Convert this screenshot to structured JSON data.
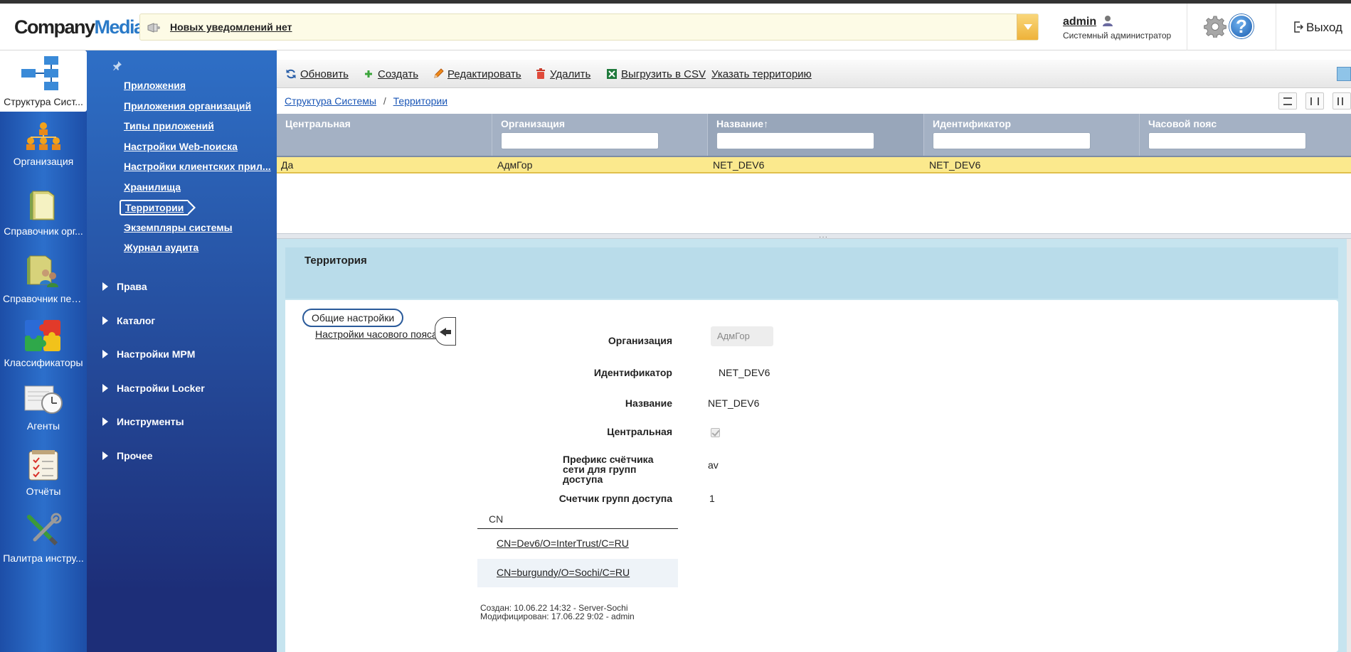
{
  "header": {
    "logo_company": "Company",
    "logo_media": "Media",
    "notification": "Новых уведомлений нет",
    "user_name": "admin",
    "user_role": "Системный администратор",
    "help_symbol": "?",
    "logout": "Выход"
  },
  "rail": {
    "items": [
      {
        "label": "Структура Сист...",
        "icon": "structure-icon",
        "active": true
      },
      {
        "label": "Организация",
        "icon": "org-chart-icon"
      },
      {
        "label": "Справочник орг...",
        "icon": "folder-icon"
      },
      {
        "label": "Справочник пер...",
        "icon": "people-folder-icon"
      },
      {
        "label": "Классификаторы",
        "icon": "puzzle-icon"
      },
      {
        "label": "Агенты",
        "icon": "clock-icon"
      },
      {
        "label": "Отчёты",
        "icon": "report-icon"
      },
      {
        "label": "Палитра инстру...",
        "icon": "tools-icon"
      }
    ]
  },
  "nav": {
    "links": [
      "Приложения",
      "Приложения организаций",
      "Типы приложений",
      "Настройки Web-поиска",
      "Настройки клиентских прил...",
      "Хранилища",
      "Территории",
      "Экземпляры системы",
      "Журнал аудита"
    ],
    "active": "Территории",
    "groups": [
      "Права",
      "Каталог",
      "Настройки MPM",
      "Настройки Locker",
      "Инструменты",
      "Прочее"
    ]
  },
  "toolbar": {
    "refresh": "Обновить",
    "create": "Создать",
    "edit": "Редактировать",
    "delete": "Удалить",
    "export_csv": "Выгрузить в CSV",
    "set_territory": "Указать территорию"
  },
  "breadcrumb": {
    "root": "Структура Системы",
    "separator": "/",
    "current": "Территории"
  },
  "grid": {
    "columns": [
      "Центральная",
      "Организация",
      "Название↑",
      "Идентификатор",
      "Часовой пояс"
    ],
    "rows": [
      [
        "Да",
        "АдмГор",
        "NET_DEV6",
        "NET_DEV6",
        ""
      ]
    ]
  },
  "detail": {
    "title": "Территория",
    "tabs": [
      "Общие настройки",
      "Настройки часового пояса"
    ],
    "fields": {
      "organization_label": "Организация",
      "organization_value": "АдмГор",
      "identifier_label": "Идентификатор",
      "identifier_value": "NET_DEV6",
      "name_label": "Название",
      "name_value": "NET_DEV6",
      "central_label": "Центральная",
      "central_checked": true,
      "prefix_label": "Префикс счётчика сети для групп доступа",
      "prefix_value": "av",
      "counter_label": "Счетчик групп доступа",
      "counter_value": "1"
    },
    "cn_header": "CN",
    "cn_rows": [
      "CN=Dev6/O=InterTrust/C=RU",
      "CN=burgundy/O=Sochi/C=RU"
    ],
    "created": "Создан: 10.06.22 14:32 - Server-Sochi",
    "modified": "Модифицирован: 17.06.22 9:02 -  admin"
  }
}
